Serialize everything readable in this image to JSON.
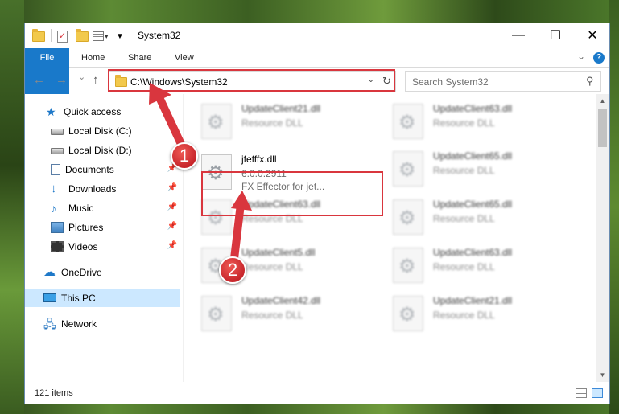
{
  "window": {
    "title": "System32"
  },
  "titlebar": {
    "controls": {
      "minimize": "—",
      "maximize": "☐",
      "close": "✕"
    },
    "qat_dropdown": "▾"
  },
  "ribbon": {
    "tabs": [
      "File",
      "Home",
      "Share",
      "View"
    ],
    "expand_glyph": "⌄",
    "help_glyph": "?"
  },
  "nav": {
    "back": "←",
    "forward": "→",
    "recent": "⌄",
    "up": "↑",
    "address": "C:\\Windows\\System32",
    "address_drop": "⌄",
    "refresh": "↻",
    "search_placeholder": "Search System32",
    "search_glyph": "⚲"
  },
  "sidebar": {
    "items": [
      {
        "label": "Quick access",
        "icon": "star-icon"
      },
      {
        "label": "Local Disk (C:)",
        "icon": "drive-icon"
      },
      {
        "label": "Local Disk (D:)",
        "icon": "drive-icon"
      },
      {
        "label": "Documents",
        "icon": "documents-icon",
        "pinned": true
      },
      {
        "label": "Downloads",
        "icon": "download-icon",
        "pinned": true
      },
      {
        "label": "Music",
        "icon": "music-icon",
        "pinned": true
      },
      {
        "label": "Pictures",
        "icon": "pictures-icon",
        "pinned": true
      },
      {
        "label": "Videos",
        "icon": "videos-icon",
        "pinned": true
      },
      {
        "label": "OneDrive",
        "icon": "cloud-icon"
      },
      {
        "label": "This PC",
        "icon": "computer-icon",
        "selected": true
      },
      {
        "label": "Network",
        "icon": "network-icon"
      }
    ],
    "pin_glyph": "📌"
  },
  "files": {
    "left": [
      {
        "name": "UpdateClient21.dll",
        "line2": "Resource DLL",
        "line3": ""
      },
      {
        "name": "jfefffx.dll",
        "line2": "6.0.0.2911",
        "line3": "FX Effector for jet...",
        "highlighted": true
      },
      {
        "name": "UpdateClient63.dll",
        "line2": "Resource DLL",
        "line3": ""
      },
      {
        "name": "UpdateClient5.dll",
        "line2": "Resource DLL",
        "line3": ""
      },
      {
        "name": "UpdateClient42.dll",
        "line2": "Resource DLL",
        "line3": ""
      }
    ],
    "right": [
      {
        "name": "UpdateClient63.dll",
        "line2": "Resource DLL",
        "line3": ""
      },
      {
        "name": "UpdateClient65.dll",
        "line2": "Resource DLL",
        "line3": ""
      },
      {
        "name": "UpdateClient65.dll",
        "line2": "Resource DLL",
        "line3": ""
      },
      {
        "name": "UpdateClient63.dll",
        "line2": "Resource DLL",
        "line3": ""
      },
      {
        "name": "UpdateClient21.dll",
        "line2": "Resource DLL",
        "line3": ""
      }
    ]
  },
  "status": {
    "item_count": "121 items"
  },
  "annotations": {
    "step1": "1",
    "step2": "2",
    "color": "#d9363e"
  }
}
